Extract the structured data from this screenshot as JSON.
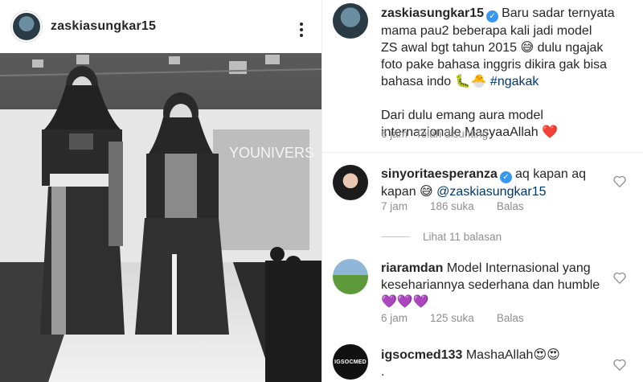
{
  "post": {
    "username": "zaskiasungkar15",
    "image_alt": "Two models in hijab on runway"
  },
  "caption": {
    "username": "zaskiasungkar15",
    "line1": "Baru sadar ternyata",
    "line2": "mama pau2 beberapa kali jadi model",
    "line3": "ZS awal bgt tahun 2015 😅 dulu ngajak",
    "line4": "foto pake bahasa inggris dikira gak bisa",
    "line5_pre": "bahasa indo 🐛🐣 ",
    "hashtag": "#ngakak",
    "line6": "Dari dulu emang aura model",
    "line7": "internazionale MasyaaAllah ❤️",
    "time": "6 jam",
    "edited": "Telah disunting"
  },
  "comments": [
    {
      "username": "sinyoritaesperanza",
      "text_pre": "aq kapan aq",
      "text_line2": "kapan 😅 ",
      "mention": "@zaskiasungkar15",
      "time": "7 jam",
      "likes": "186 suka",
      "reply": "Balas",
      "view_replies": "Lihat 11 balasan"
    },
    {
      "username": "riaramdan",
      "text_line1": "Model Internasional yang",
      "text_line2": "kesehariannya sederhana dan humble",
      "text_line3": "💜💜💜",
      "time": "6 jam",
      "likes": "125 suka",
      "reply": "Balas"
    },
    {
      "username": "igsocmed133",
      "text_line1": "MashaAllah😍😍",
      "text_line2": ".",
      "avatar_text": "IGSOCMED"
    }
  ],
  "colors": {
    "verified": "#3897f0",
    "link": "#00376b",
    "meta": "#8e8e8e"
  },
  "icons": {
    "more": "more-options-icon",
    "heart": "heart-icon",
    "verified": "verified-badge-icon"
  }
}
